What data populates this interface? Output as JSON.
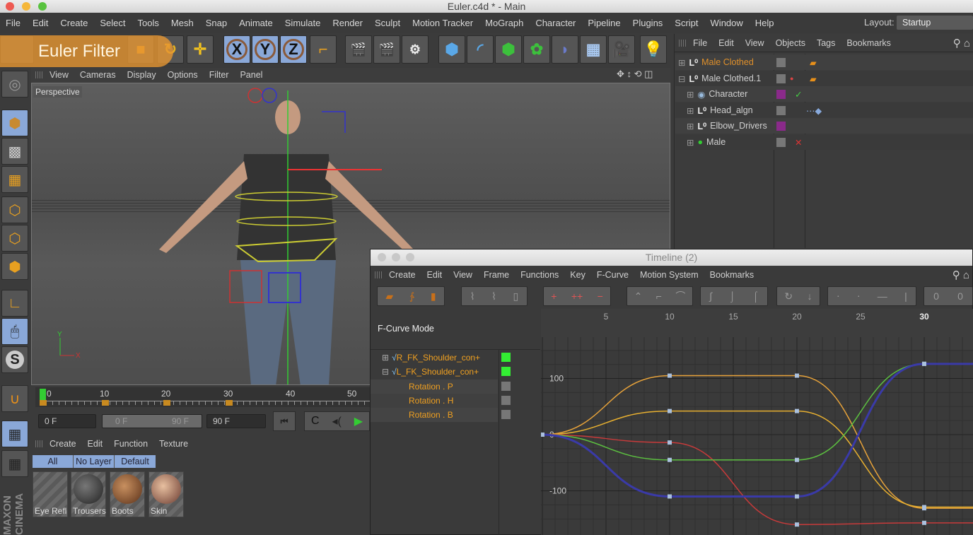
{
  "window": {
    "title": "Euler.c4d * - Main"
  },
  "menu": [
    "File",
    "Edit",
    "Create",
    "Select",
    "Tools",
    "Mesh",
    "Snap",
    "Animate",
    "Simulate",
    "Render",
    "Sculpt",
    "Motion Tracker",
    "MoGraph",
    "Character",
    "Pipeline",
    "Plugins",
    "Script",
    "Window",
    "Help"
  ],
  "layout": {
    "label": "Layout:",
    "value": "Startup"
  },
  "overlay": {
    "text": "Euler Filter"
  },
  "toolbar": {
    "axis_x": "X",
    "axis_y": "Y",
    "axis_z": "Z"
  },
  "viewport": {
    "menu": [
      "View",
      "Cameras",
      "Display",
      "Options",
      "Filter",
      "Panel"
    ],
    "camera": "Perspective",
    "axis_y": "Y",
    "axis_x": "X"
  },
  "objects": {
    "menu": [
      "File",
      "Edit",
      "View",
      "Objects",
      "Tags",
      "Bookmarks"
    ],
    "items": [
      {
        "name": "Male Clothed",
        "color": "#e0902a"
      },
      {
        "name": "Male Clothed.1",
        "color": "#d0d0d0"
      },
      {
        "name": "Character",
        "color": "#d0d0d0"
      },
      {
        "name": "Head_algn",
        "color": "#d0d0d0"
      },
      {
        "name": "Elbow_Drivers",
        "color": "#d0d0d0"
      },
      {
        "name": "Male",
        "color": "#d0d0d0"
      }
    ]
  },
  "timeslider": {
    "ticks": [
      "0",
      "10",
      "20",
      "30",
      "40",
      "50"
    ],
    "current_frame": 0
  },
  "transport": {
    "start": "0 F",
    "range_start": "0 F",
    "range_end": "90 F",
    "end": "90 F"
  },
  "materials": {
    "menu": [
      "Create",
      "Edit",
      "Function",
      "Texture"
    ],
    "filters": [
      "All",
      "No Layer",
      "Default"
    ],
    "items": [
      "Eye Refl",
      "Trousers",
      "Boots",
      "Skin"
    ]
  },
  "timeline": {
    "title": "Timeline (2)",
    "menu": [
      "Create",
      "Edit",
      "View",
      "Frame",
      "Functions",
      "Key",
      "F-Curve",
      "Motion System",
      "Bookmarks"
    ],
    "mode": "F-Curve Mode",
    "tracks": [
      {
        "name": "R_FK_Shoulder_con+",
        "expand": "⊞"
      },
      {
        "name": "L_FK_Shoulder_con+",
        "expand": "⊟"
      },
      {
        "name": "Rotation . P"
      },
      {
        "name": "Rotation . H"
      },
      {
        "name": "Rotation . B"
      }
    ]
  },
  "chart_data": {
    "type": "line",
    "x_ticks": [
      5,
      10,
      15,
      20,
      25,
      30
    ],
    "y_ticks": [
      100,
      0,
      -100
    ],
    "xlim": [
      0,
      34
    ],
    "ylim": [
      -170,
      150
    ],
    "grid": true,
    "series": [
      {
        "color": "#e8a33a",
        "x": [
          0,
          10,
          20,
          30
        ],
        "y": [
          0,
          105,
          105,
          -131
        ]
      },
      {
        "color": "#e8b030",
        "x": [
          0,
          10,
          20,
          30
        ],
        "y": [
          0,
          42,
          42,
          -129
        ]
      },
      {
        "color": "#c83a3a",
        "x": [
          0,
          10,
          20,
          30
        ],
        "y": [
          0,
          -14,
          -160,
          -157
        ]
      },
      {
        "color": "#5cc040",
        "x": [
          0,
          10,
          20,
          30
        ],
        "y": [
          0,
          -45,
          -45,
          126
        ]
      },
      {
        "color": "#3a3aa8",
        "x": [
          0,
          10,
          20,
          30
        ],
        "y": [
          0,
          -110,
          -110,
          126
        ]
      }
    ]
  }
}
